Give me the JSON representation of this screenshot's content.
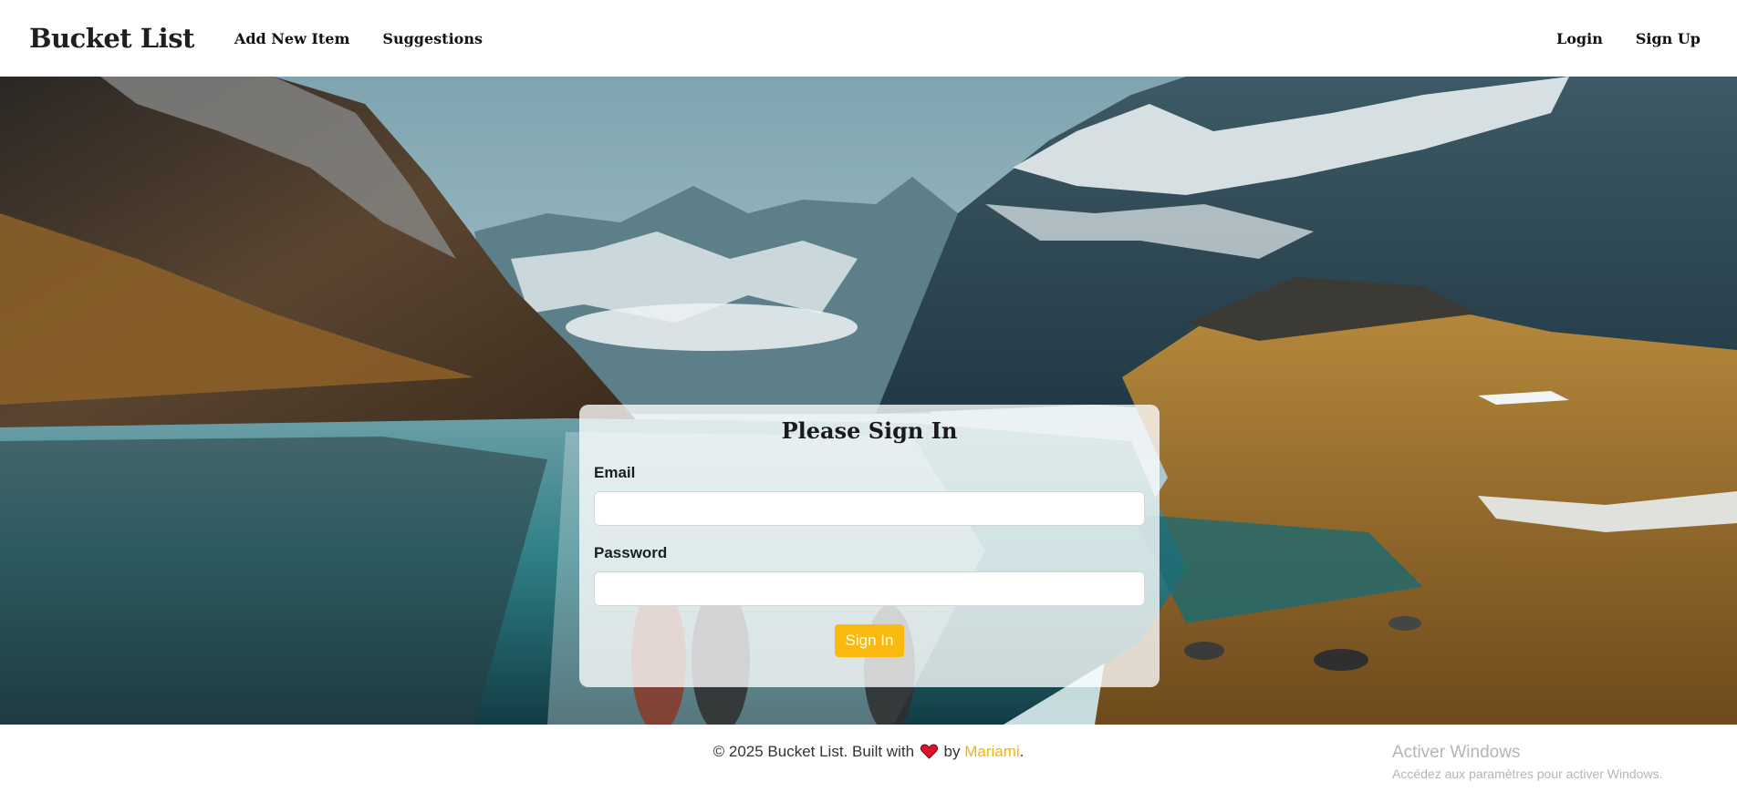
{
  "navbar": {
    "brand": "Bucket List",
    "left_links": [
      "Add New Item",
      "Suggestions"
    ],
    "right_links": [
      "Login",
      "Sign Up"
    ]
  },
  "hero": {
    "background": "mountain-lake-landscape",
    "colors": {
      "sky": "#aec7cf",
      "water": "#2f7f86",
      "grass": "#a4762f"
    }
  },
  "signin": {
    "title": "Please Sign In",
    "email_label": "Email",
    "email_value": "",
    "password_label": "Password",
    "password_value": "",
    "button_label": "Sign In",
    "accent": "#f9b90e"
  },
  "footer": {
    "prefix": "© 2025 Bucket List. Built with",
    "heart_icon": "heart-icon",
    "by": "by",
    "author": "Mariami",
    "suffix": ".",
    "author_color": "#f5b301"
  },
  "watermark": {
    "title": "Activer Windows",
    "subtitle": "Accédez aux paramètres pour activer Windows."
  }
}
